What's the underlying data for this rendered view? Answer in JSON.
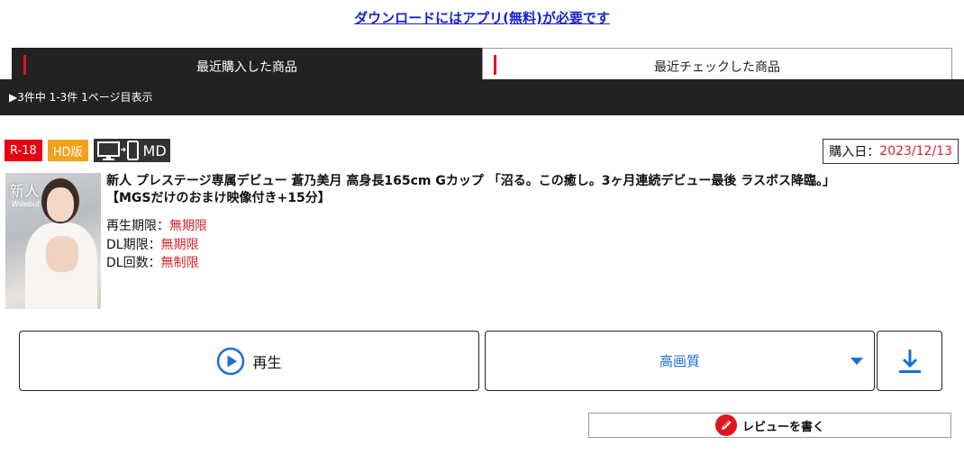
{
  "header": {
    "download_notice": "ダウンロードにはアプリ(無料)が必要です"
  },
  "tabs": [
    {
      "label": "最近購入した商品",
      "active": true
    },
    {
      "label": "最近チェックした商品",
      "active": false
    }
  ],
  "results": {
    "summary": "▶3件中 1-3件 1ページ目表示"
  },
  "item": {
    "badges": {
      "r18": "R-18",
      "hd": "HD版",
      "md": "MD"
    },
    "purchase_label": "購入日：",
    "purchase_date": "2023/12/13",
    "title_line1": "新人 プレステージ専属デビュー 蒼乃美月 高身長165cm Gカップ 「沼る。この癒し。3ヶ月連続デビュー最後 ラスボス降臨。」",
    "title_line2": "【MGSだけのおまけ映像付き+15分】",
    "thumbnail_text": {
      "main": "新人",
      "sub": "Wdebut"
    },
    "meta": [
      {
        "label": "再生期限：",
        "value": "無期限"
      },
      {
        "label": "DL期限：",
        "value": "無期限"
      },
      {
        "label": "DL回数：",
        "value": "無制限"
      }
    ]
  },
  "actions": {
    "play_label": "再生",
    "quality_label": "高画質",
    "review_label": "レビューを書く"
  },
  "colors": {
    "accent_red": "#e0161f",
    "link_blue": "#1a24c8",
    "action_blue": "#1a6fd6",
    "hd_orange": "#f4a11a"
  },
  "icons": {
    "play": "play-circle-icon",
    "download": "download-icon",
    "review": "pen-icon",
    "device": "pc-smartphone-icon",
    "caret": "caret-down-icon"
  }
}
